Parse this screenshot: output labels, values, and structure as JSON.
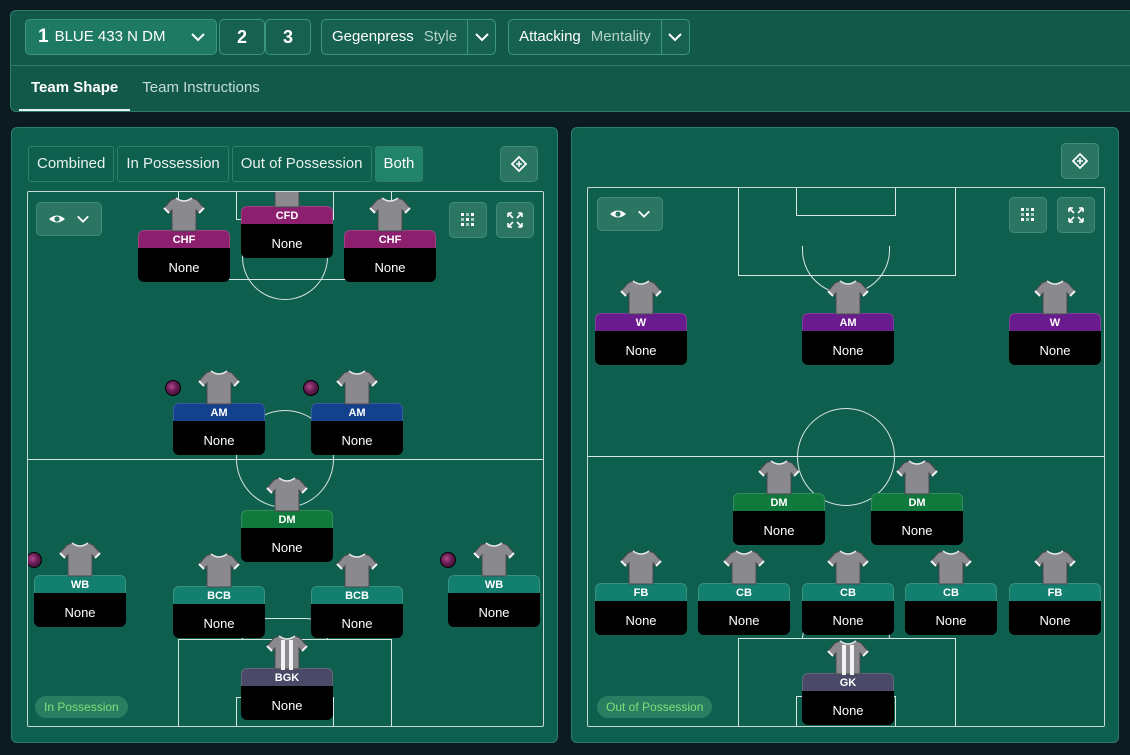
{
  "tactic": {
    "selected_number": "1",
    "selected_name": "BLUE 433 N DM",
    "slot_2": "2",
    "slot_3": "3",
    "style_value": "Gegenpress",
    "style_label": "Style",
    "mentality_value": "Attacking",
    "mentality_label": "Mentality"
  },
  "tabs": [
    {
      "label": "Team Shape",
      "active": true
    },
    {
      "label": "Team Instructions",
      "active": false
    }
  ],
  "view_tabs": [
    {
      "label": "Combined"
    },
    {
      "label": "In Possession"
    },
    {
      "label": "Out of Possession"
    },
    {
      "label": "Both",
      "selected": true
    }
  ],
  "left_pitch": {
    "phase_label": "In Possession",
    "players": [
      {
        "role": "CFD",
        "name": "None",
        "color": "purple",
        "ball": false
      },
      {
        "role": "CHF",
        "name": "None",
        "color": "purple",
        "ball": false
      },
      {
        "role": "CHF",
        "name": "None",
        "color": "purple",
        "ball": false
      },
      {
        "role": "AM",
        "name": "None",
        "color": "blue",
        "ball": true
      },
      {
        "role": "AM",
        "name": "None",
        "color": "blue",
        "ball": true
      },
      {
        "role": "DM",
        "name": "None",
        "color": "green",
        "ball": false
      },
      {
        "role": "WB",
        "name": "None",
        "color": "teal",
        "ball": true
      },
      {
        "role": "BCB",
        "name": "None",
        "color": "teal",
        "ball": false
      },
      {
        "role": "BCB",
        "name": "None",
        "color": "teal",
        "ball": false
      },
      {
        "role": "WB",
        "name": "None",
        "color": "teal",
        "ball": true
      },
      {
        "role": "BGK",
        "name": "None",
        "color": "gk",
        "ball": false
      }
    ]
  },
  "right_pitch": {
    "phase_label": "Out of Possession",
    "players": [
      {
        "role": "W",
        "name": "None",
        "color": "violet"
      },
      {
        "role": "AM",
        "name": "None",
        "color": "violet"
      },
      {
        "role": "W",
        "name": "None",
        "color": "violet"
      },
      {
        "role": "DM",
        "name": "None",
        "color": "green"
      },
      {
        "role": "DM",
        "name": "None",
        "color": "green"
      },
      {
        "role": "FB",
        "name": "None",
        "color": "teal"
      },
      {
        "role": "CB",
        "name": "None",
        "color": "teal"
      },
      {
        "role": "CB",
        "name": "None",
        "color": "teal"
      },
      {
        "role": "CB",
        "name": "None",
        "color": "teal"
      },
      {
        "role": "FB",
        "name": "None",
        "color": "teal"
      },
      {
        "role": "GK",
        "name": "None",
        "color": "gk"
      }
    ]
  },
  "icons": {
    "tactic_dropdown": "chevron-down-icon",
    "visibility": "eye-icon",
    "grid": "grid-icon",
    "expand": "expand-icon",
    "tactics_board": "tactics-board-icon"
  }
}
